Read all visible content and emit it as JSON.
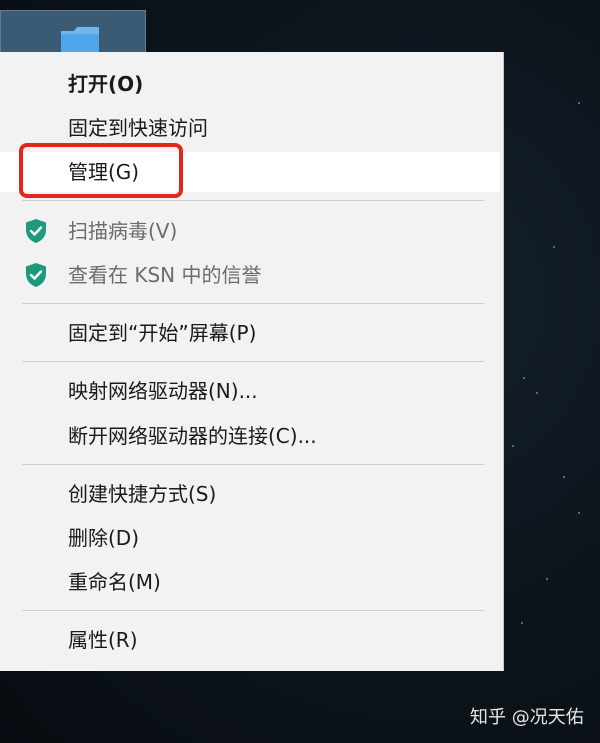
{
  "menu": {
    "open": "打开(O)",
    "pin_quick_access": "固定到快速访问",
    "manage": "管理(G)",
    "scan_virus": "扫描病毒(V)",
    "ksn_reputation": "查看在 KSN 中的信誉",
    "pin_start": "固定到“开始”屏幕(P)",
    "map_drive": "映射网络驱动器(N)...",
    "disconnect_drive": "断开网络驱动器的连接(C)...",
    "create_shortcut": "创建快捷方式(S)",
    "delete": "删除(D)",
    "rename": "重命名(M)",
    "properties": "属性(R)"
  },
  "icons": {
    "desktop_item": "folder-icon",
    "antivirus": "kaspersky-shield-icon"
  },
  "colors": {
    "highlight_box": "#e3261c",
    "shield": "#1d9a7e"
  },
  "watermark": "知乎 @况天佑"
}
